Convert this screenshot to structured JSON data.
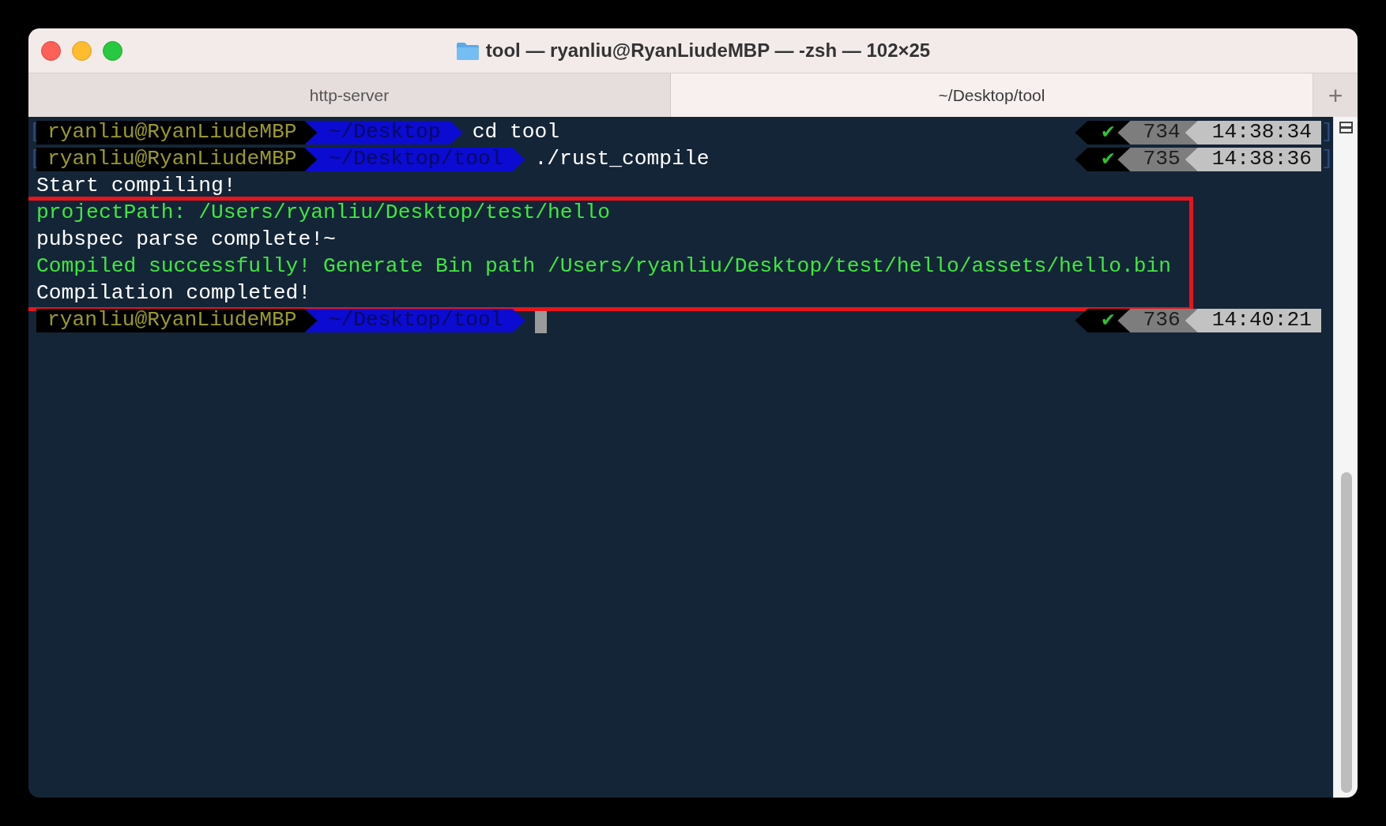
{
  "window": {
    "title": "tool — ryanliu@RyanLiudeMBP — -zsh — 102×25"
  },
  "tabs": [
    {
      "label": "http-server",
      "selected": false
    },
    {
      "label": "~/Desktop/tool",
      "selected": true
    }
  ],
  "new_tab": "+",
  "terminal": {
    "lines": [
      {
        "kind": "prompt",
        "open_bracket": "[",
        "user": "ryanliu@RyanLiudeMBP",
        "path": "~/Desktop",
        "command": "cd tool",
        "status": "✔",
        "number": "734",
        "time": "14:38:34",
        "close_bracket": "]",
        "cursor": false,
        "highlighted": false
      },
      {
        "kind": "prompt",
        "open_bracket": "[",
        "user": "ryanliu@RyanLiudeMBP",
        "path": "~/Desktop/tool",
        "command": "./rust_compile",
        "status": "✔",
        "number": "735",
        "time": "14:38:36",
        "close_bracket": "]",
        "cursor": false,
        "highlighted": false
      },
      {
        "kind": "output",
        "text": "Start compiling!",
        "color": "#ffffff",
        "highlighted": false
      },
      {
        "kind": "output",
        "text": "projectPath: /Users/ryanliu/Desktop/test/hello",
        "color": "#3ee83e",
        "highlighted": true
      },
      {
        "kind": "output",
        "text": "pubspec parse complete!~",
        "color": "#ffffff",
        "highlighted": true
      },
      {
        "kind": "output",
        "text": "Compiled successfully! Generate Bin path /Users/ryanliu/Desktop/test/hello/assets/hello.bin",
        "color": "#3ee83e",
        "highlighted": true
      },
      {
        "kind": "output",
        "text": "Compilation completed!",
        "color": "#ffffff",
        "highlighted": true
      },
      {
        "kind": "prompt",
        "user": "ryanliu@RyanLiudeMBP",
        "path": "~/Desktop/tool",
        "status": "✔",
        "number": "736",
        "time": "14:40:21",
        "cursor": true,
        "highlighted": false
      }
    ]
  }
}
